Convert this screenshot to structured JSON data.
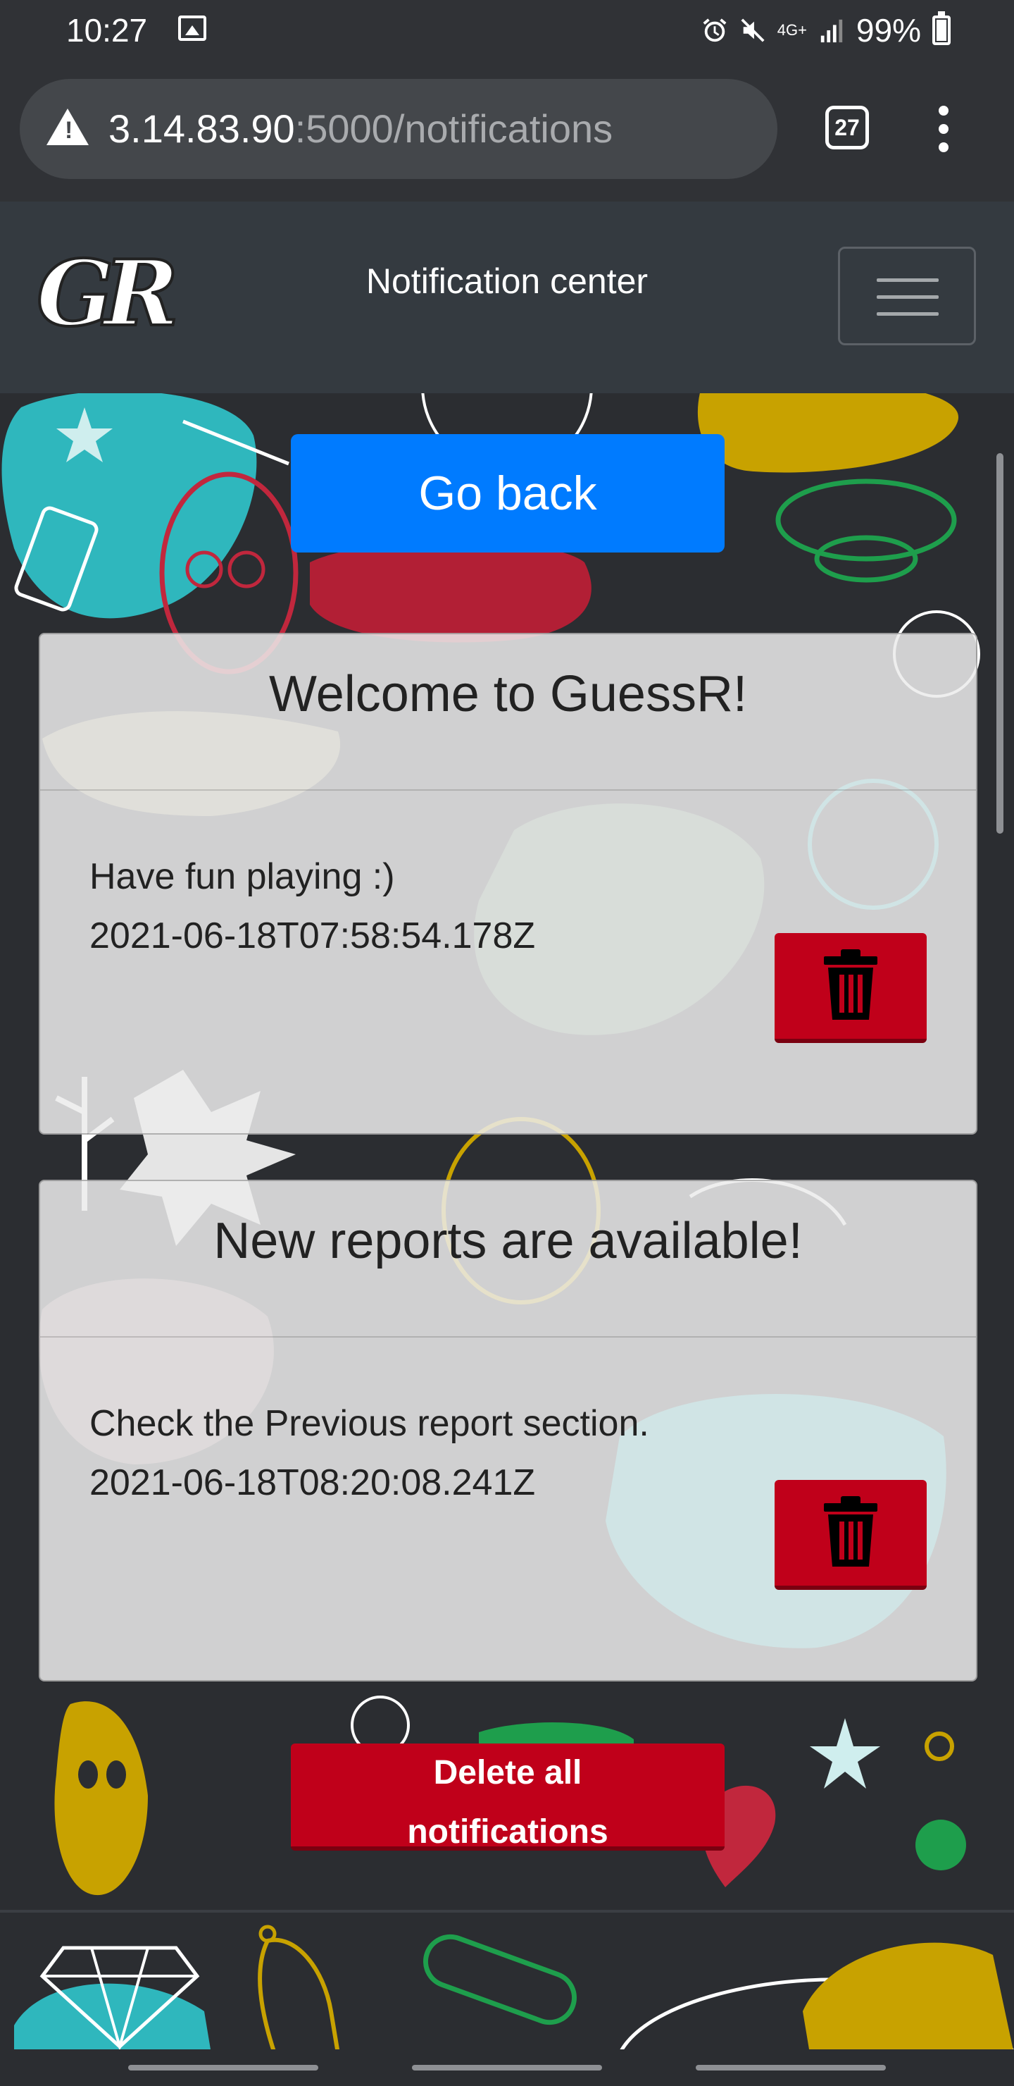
{
  "status_bar": {
    "time": "10:27",
    "network": "4G+",
    "battery": "99%"
  },
  "browser": {
    "url_host": "3.14.83.90",
    "url_path": ":5000/notifications",
    "tab_count": "27"
  },
  "navbar": {
    "logo_text": "GR",
    "title": "Notification center"
  },
  "go_back_label": "Go back",
  "notifications": [
    {
      "title": "Welcome to GuessR!",
      "message": "Have fun playing :)",
      "timestamp": "2021-06-18T07:58:54.178Z"
    },
    {
      "title": "New reports are available!",
      "message": "Check the Previous report section.",
      "timestamp": "2021-06-18T08:20:08.241Z"
    }
  ],
  "delete_all": {
    "line1": "Delete all",
    "line2": "notifications"
  },
  "colors": {
    "primary": "#007bff",
    "danger": "#c0001a",
    "navbar": "#343a40"
  }
}
